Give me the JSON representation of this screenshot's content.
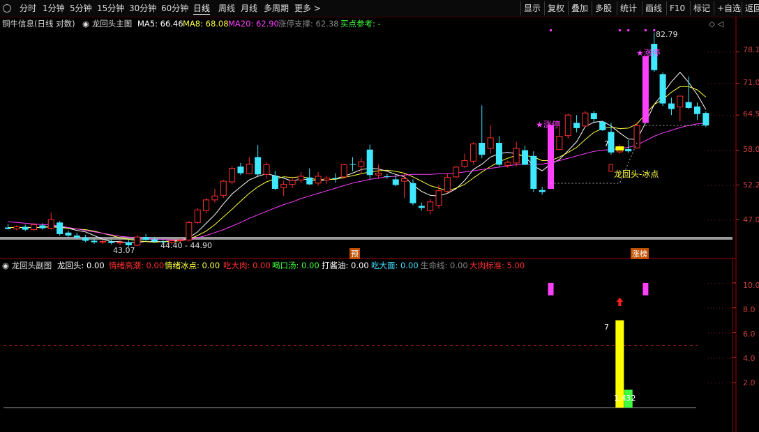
{
  "toolbar": {
    "periods": [
      "分时",
      "1分钟",
      "5分钟",
      "15分钟",
      "30分钟",
      "60分钟",
      "日线",
      "周线",
      "月线",
      "多周期",
      "更多"
    ],
    "active_period": "日线",
    "more_arrow": ">",
    "right_buttons": [
      "显示",
      "复权",
      "叠加",
      "多股",
      "统计",
      "画线",
      "F10",
      "标记",
      "+自选",
      "返回"
    ]
  },
  "main_header": {
    "stock": "铜牛信息(日线 对数)",
    "indicator": "龙回头主图",
    "ma5": "MA5: 66.46",
    "ma8": "MA8: 68.08",
    "ma20": "MA20: 62.90",
    "limit_support": "涨停支撑: 62.38",
    "buy_ref": "买点参考: -",
    "tools_glyph": "◇ ◁"
  },
  "sub_header": {
    "title": "龙回头副图",
    "items": [
      {
        "text": "龙回头: 0.00",
        "color": "#ffffff"
      },
      {
        "text": "情绪高潮: 0.00",
        "color": "#ff3030"
      },
      {
        "text": "情绪冰点: 0.00",
        "color": "#ffff40"
      },
      {
        "text": "吃大肉: 0.00",
        "color": "#ff3030"
      },
      {
        "text": "喝口汤: 0.00",
        "color": "#40ff40"
      },
      {
        "text": "打酱油: 0.00",
        "color": "#ffffff"
      },
      {
        "text": "吃大面: 0.00",
        "color": "#40e0ff"
      },
      {
        "text": "生命线: 0.00",
        "color": "#888888"
      },
      {
        "text": "大肉标准: 5.00",
        "color": "#ff3030"
      }
    ]
  },
  "annotations": {
    "high": "82.79",
    "low": "43.07",
    "range": "44.40 - 44.90",
    "limit_up_1": "★涨停",
    "limit_up_2": "★涨停",
    "dragon_ice": "龙回头-冰点",
    "seven_main": "7",
    "badge_pre": "预",
    "badge_zt": "涨榜",
    "sub_seven": "7",
    "sub_value": "1.432"
  },
  "chart_data": [
    {
      "type": "candlestick",
      "title": "龙回头主图",
      "y_scale": "log",
      "ylim": [
        43.5,
        84.5
      ],
      "y_ticks": [
        "78.1",
        "71.0",
        "64.5",
        "58.0",
        "52.2",
        "47.0"
      ],
      "candles": [
        [
          45.9,
          46.4,
          45.6,
          45.7
        ],
        [
          45.7,
          46.2,
          45.5,
          46.0
        ],
        [
          46.0,
          46.3,
          45.4,
          45.6
        ],
        [
          45.6,
          46.5,
          45.5,
          46.3
        ],
        [
          46.2,
          46.5,
          45.6,
          45.8
        ],
        [
          45.8,
          48.0,
          45.6,
          47.0
        ],
        [
          46.6,
          46.8,
          44.8,
          45.0
        ],
        [
          45.2,
          45.5,
          44.6,
          44.8
        ],
        [
          44.8,
          45.2,
          44.4,
          44.5
        ],
        [
          44.5,
          44.9,
          43.9,
          44.1
        ],
        [
          44.1,
          44.4,
          43.7,
          43.9
        ],
        [
          43.9,
          44.3,
          43.7,
          44.0
        ],
        [
          44.0,
          44.3,
          43.6,
          43.8
        ],
        [
          43.8,
          44.2,
          43.5,
          43.9
        ],
        [
          43.9,
          44.2,
          43.3,
          43.5
        ],
        [
          43.5,
          44.8,
          43.4,
          44.6
        ],
        [
          44.6,
          45.0,
          44.1,
          44.2
        ],
        [
          44.3,
          44.6,
          43.8,
          44.0
        ],
        [
          44.0,
          44.3,
          43.7,
          43.9
        ],
        [
          43.9,
          44.3,
          43.6,
          44.1
        ],
        [
          44.1,
          44.4,
          43.8,
          44.2
        ],
        [
          44.2,
          46.8,
          44.0,
          46.6
        ],
        [
          46.6,
          48.7,
          46.4,
          48.4
        ],
        [
          48.3,
          50.2,
          47.9,
          49.9
        ],
        [
          49.9,
          51.6,
          49.5,
          50.5
        ],
        [
          50.6,
          53.0,
          50.2,
          52.8
        ],
        [
          52.7,
          55.3,
          52.3,
          54.9
        ],
        [
          55.2,
          55.8,
          53.8,
          54.1
        ],
        [
          54.0,
          56.8,
          53.9,
          55.6
        ],
        [
          56.8,
          58.9,
          53.6,
          53.9
        ],
        [
          53.9,
          55.9,
          53.2,
          55.5
        ],
        [
          53.7,
          54.5,
          51.4,
          51.6
        ],
        [
          51.8,
          52.9,
          50.5,
          52.3
        ],
        [
          52.3,
          53.5,
          51.7,
          52.9
        ],
        [
          53.0,
          54.3,
          52.5,
          53.6
        ],
        [
          53.4,
          54.9,
          52.2,
          52.3
        ],
        [
          52.5,
          54.3,
          52.1,
          53.6
        ],
        [
          53.0,
          53.7,
          52.4,
          53.3
        ],
        [
          53.3,
          54.1,
          52.6,
          53.2
        ],
        [
          53.5,
          55.7,
          53.2,
          55.5
        ],
        [
          55.6,
          56.8,
          54.4,
          55.5
        ],
        [
          55.2,
          56.6,
          54.0,
          56.0
        ],
        [
          58.1,
          59.0,
          53.2,
          53.8
        ],
        [
          53.8,
          55.5,
          53.2,
          54.1
        ],
        [
          53.6,
          54.0,
          53.2,
          53.5
        ],
        [
          53.1,
          53.8,
          52.0,
          52.2
        ],
        [
          52.8,
          54.0,
          50.2,
          53.2
        ],
        [
          52.5,
          53.1,
          49.1,
          49.4
        ],
        [
          49.0,
          49.5,
          48.3,
          48.7
        ],
        [
          48.3,
          50.0,
          47.8,
          49.6
        ],
        [
          49.1,
          52.2,
          48.6,
          51.3
        ],
        [
          51.2,
          54.0,
          50.9,
          53.4
        ],
        [
          53.5,
          55.3,
          53.3,
          55.1
        ],
        [
          55.2,
          57.4,
          55.0,
          56.2
        ],
        [
          56.1,
          59.4,
          55.5,
          59.1
        ],
        [
          59.3,
          66.4,
          56.6,
          57.2
        ],
        [
          58.3,
          62.6,
          57.4,
          60.2
        ],
        [
          59.3,
          60.5,
          55.2,
          55.5
        ],
        [
          55.4,
          56.2,
          55.0,
          55.9
        ],
        [
          55.8,
          59.5,
          55.2,
          58.3
        ],
        [
          58.0,
          58.8,
          55.4,
          55.5
        ],
        [
          57.0,
          57.8,
          51.1,
          51.6
        ],
        [
          51.4,
          51.9,
          50.7,
          51.1
        ],
        [
          51.6,
          62.6,
          51.6,
          62.6
        ],
        [
          58.1,
          63.4,
          58.1,
          60.5
        ],
        [
          60.6,
          64.8,
          60.1,
          64.5
        ],
        [
          63.0,
          64.5,
          61.2,
          62.0
        ],
        [
          62.4,
          65.3,
          62.1,
          64.9
        ],
        [
          64.9,
          65.3,
          63.1,
          63.7
        ],
        [
          63.2,
          63.4,
          61.5,
          61.6
        ],
        [
          61.3,
          63.0,
          57.2,
          57.6
        ],
        [
          57.7,
          59.0,
          57.4,
          58.5
        ],
        [
          58.2,
          59.8,
          57.5,
          57.8
        ],
        [
          58.4,
          63.1,
          58.3,
          62.5
        ],
        [
          63.0,
          77.1,
          62.9,
          77.1
        ],
        [
          80.0,
          82.8,
          73.5,
          73.9
        ],
        [
          73.0,
          73.4,
          66.3,
          66.8
        ],
        [
          66.8,
          68.0,
          64.5,
          65.7
        ],
        [
          66.1,
          68.4,
          63.3,
          68.3
        ],
        [
          67.1,
          72.5,
          65.7,
          65.9
        ],
        [
          66.2,
          67.0,
          63.5,
          64.7
        ],
        [
          64.9,
          65.2,
          62.2,
          62.5
        ]
      ],
      "ma": [
        {
          "name": "MA5",
          "color": "#ffffff",
          "values": [
            45.9,
            45.9,
            45.9,
            45.9,
            45.9,
            46.1,
            46.0,
            45.8,
            45.5,
            45.3,
            44.8,
            44.3,
            44.0,
            44.0,
            43.8,
            43.9,
            44.0,
            44.0,
            44.0,
            44.1,
            44.1,
            44.5,
            45.3,
            46.5,
            47.7,
            49.3,
            50.8,
            51.9,
            53.0,
            53.6,
            54.0,
            53.7,
            53.3,
            52.8,
            53.2,
            53.0,
            52.9,
            53.0,
            53.2,
            53.6,
            54.1,
            54.7,
            54.9,
            54.8,
            54.4,
            53.9,
            53.5,
            52.2,
            51.2,
            50.6,
            50.5,
            50.9,
            51.6,
            52.9,
            54.7,
            55.6,
            56.8,
            57.4,
            57.6,
            57.4,
            56.9,
            55.3,
            54.5,
            55.6,
            56.4,
            57.9,
            59.5,
            62.3,
            63.1,
            63.3,
            62.4,
            61.1,
            60.0,
            59.9,
            63.0,
            66.6,
            68.8,
            71.3,
            73.4,
            71.2,
            68.6,
            65.6
          ],
          "note": "5-day moving average"
        },
        {
          "name": "MA8",
          "color": "#ffff40",
          "values": [
            45.9,
            45.9,
            45.9,
            45.9,
            45.9,
            46.0,
            45.9,
            45.8,
            45.7,
            45.6,
            45.4,
            45.1,
            44.8,
            44.5,
            44.3,
            44.1,
            44.0,
            43.9,
            44.0,
            44.0,
            44.1,
            44.3,
            44.8,
            45.4,
            46.3,
            47.4,
            48.5,
            49.7,
            50.9,
            51.9,
            52.7,
            53.2,
            53.5,
            53.4,
            53.5,
            53.3,
            53.0,
            53.1,
            53.1,
            53.4,
            53.7,
            54.0,
            54.3,
            54.5,
            54.6,
            54.4,
            54.1,
            53.5,
            52.8,
            52.1,
            51.7,
            51.3,
            51.7,
            52.3,
            53.3,
            54.3,
            55.2,
            56.0,
            56.6,
            57.1,
            57.1,
            56.8,
            56.2,
            56.2,
            56.8,
            57.6,
            58.5,
            59.9,
            61.2,
            61.9,
            62.2,
            61.9,
            62.0,
            62.8,
            64.7,
            66.6,
            67.6,
            69.1,
            70.3,
            70.3,
            69.6,
            68.1
          ]
        },
        {
          "name": "MA20",
          "color": "#ff40ff",
          "values": [
            46.7,
            46.6,
            46.5,
            46.4,
            46.3,
            46.3,
            46.1,
            45.9,
            45.7,
            45.5,
            45.3,
            45.1,
            44.9,
            44.7,
            44.6,
            44.5,
            44.4,
            44.3,
            44.3,
            44.2,
            44.2,
            44.3,
            44.5,
            44.8,
            45.2,
            45.6,
            46.1,
            46.6,
            47.2,
            47.7,
            48.2,
            48.7,
            49.2,
            49.6,
            50.1,
            50.5,
            50.9,
            51.3,
            51.7,
            52.1,
            52.5,
            52.8,
            53.1,
            53.3,
            53.5,
            53.6,
            53.8,
            53.9,
            53.9,
            53.9,
            54.0,
            54.0,
            54.1,
            54.3,
            54.5,
            54.7,
            54.9,
            55.1,
            55.3,
            55.5,
            55.6,
            55.6,
            55.6,
            55.9,
            56.2,
            56.6,
            57.0,
            57.4,
            57.8,
            58.0,
            58.1,
            58.3,
            58.5,
            58.9,
            59.7,
            60.5,
            61.1,
            61.6,
            62.1,
            62.5,
            62.8,
            62.9
          ]
        }
      ]
    },
    {
      "type": "bar",
      "title": "龙回头副图",
      "ylim": [
        0,
        11
      ],
      "y_ticks": [
        "10.0",
        "8.0",
        "6.0",
        "4.0",
        "2.0"
      ],
      "reference_line": 5.0,
      "bars": [
        {
          "index": 63,
          "value": 10.0,
          "color": "#ff40ff"
        },
        {
          "index": 71,
          "value": 7.0,
          "color": "#ffff00"
        },
        {
          "index": 72,
          "value": 1.432,
          "color": "#40ff40"
        },
        {
          "index": 74,
          "value": 10.0,
          "color": "#ff40ff"
        }
      ]
    }
  ]
}
